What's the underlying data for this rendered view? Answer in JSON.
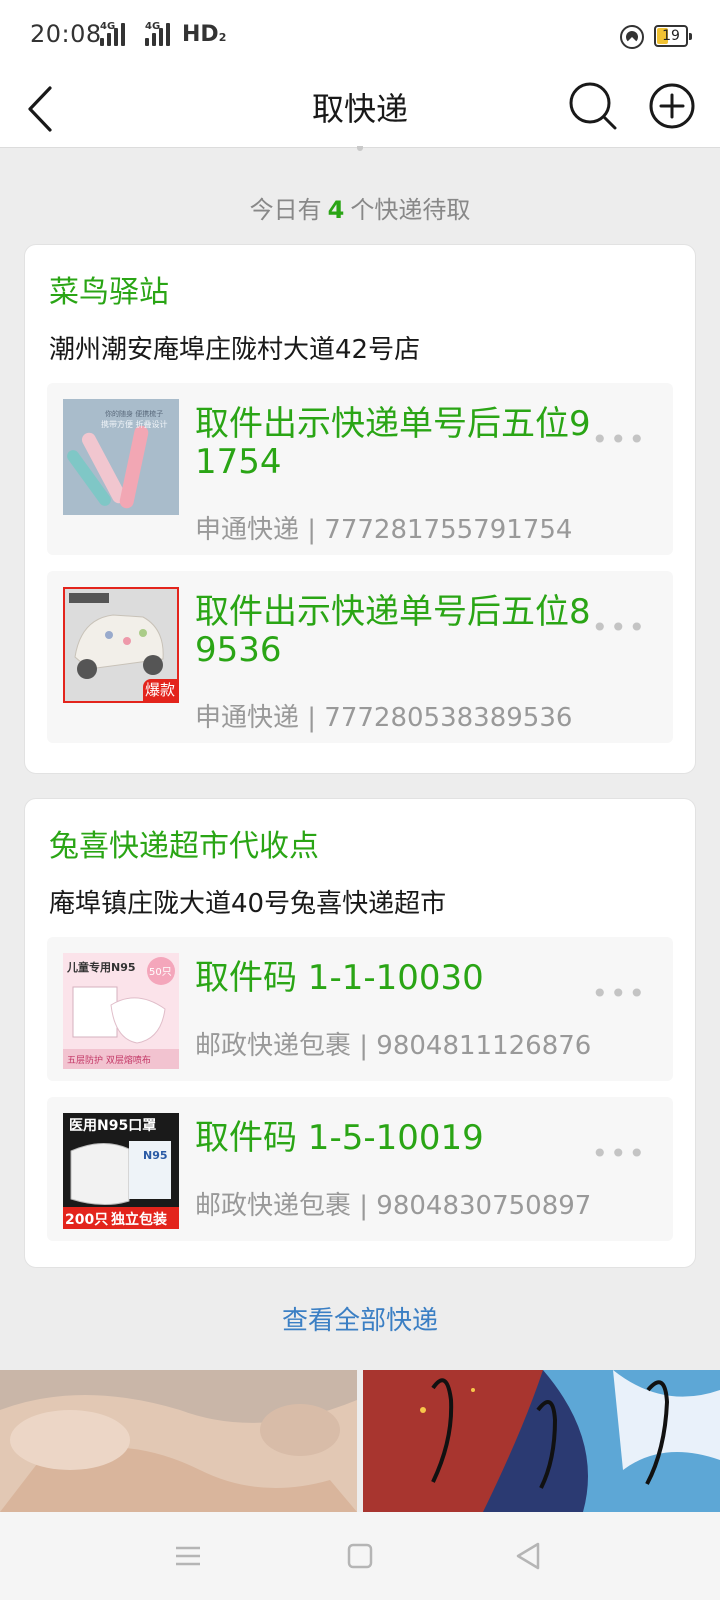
{
  "status_bar": {
    "time": "20:08",
    "net1": "4G",
    "net2": "4G",
    "hd": "HD",
    "hd_sub": "2",
    "battery": "19"
  },
  "nav": {
    "title": "取快递",
    "back_icon": "chevron-left-icon",
    "search_icon": "search-icon",
    "add_icon": "plus-circle-icon"
  },
  "summary": {
    "prefix": "今日有",
    "count": "4",
    "suffix": "个快递待取"
  },
  "stations": [
    {
      "name": "菜鸟驿站",
      "address": "潮州潮安庵埠庄陇村大道42号店",
      "parcels": [
        {
          "pickup": "取件出示快递单号后五位91754",
          "meta": "申通快递 | 777281755791754"
        },
        {
          "pickup": "取件出示快递单号后五位89536",
          "meta": "申通快递 | 777280538389536"
        }
      ]
    },
    {
      "name": "兔喜快递超市代收点",
      "address": "庵埠镇庄陇大道40号兔喜快递超市",
      "parcels": [
        {
          "pickup": "取件码 1-1-10030",
          "meta": "邮政快递包裹 | 9804811126876"
        },
        {
          "pickup": "取件码 1-5-10019",
          "meta": "邮政快递包裹 | 9804830750897"
        }
      ]
    }
  ],
  "thumb_text": {
    "t1_a": "携带方便 折叠设计",
    "t1_b": "你的随身 便携梳子",
    "t2_badge": "爆款",
    "t3_title": "儿童专用N95",
    "t3_count": "50只",
    "t3_footer": "五层防护  双层熔喷布",
    "t4_title": "医用N95口罩",
    "t4_brand": "N95",
    "t4_count": "200只",
    "t4_pack": "独立包装"
  },
  "view_all": "查看全部快递",
  "colors": {
    "accent_green": "#2aa515",
    "link_blue": "#3b7fc4"
  }
}
